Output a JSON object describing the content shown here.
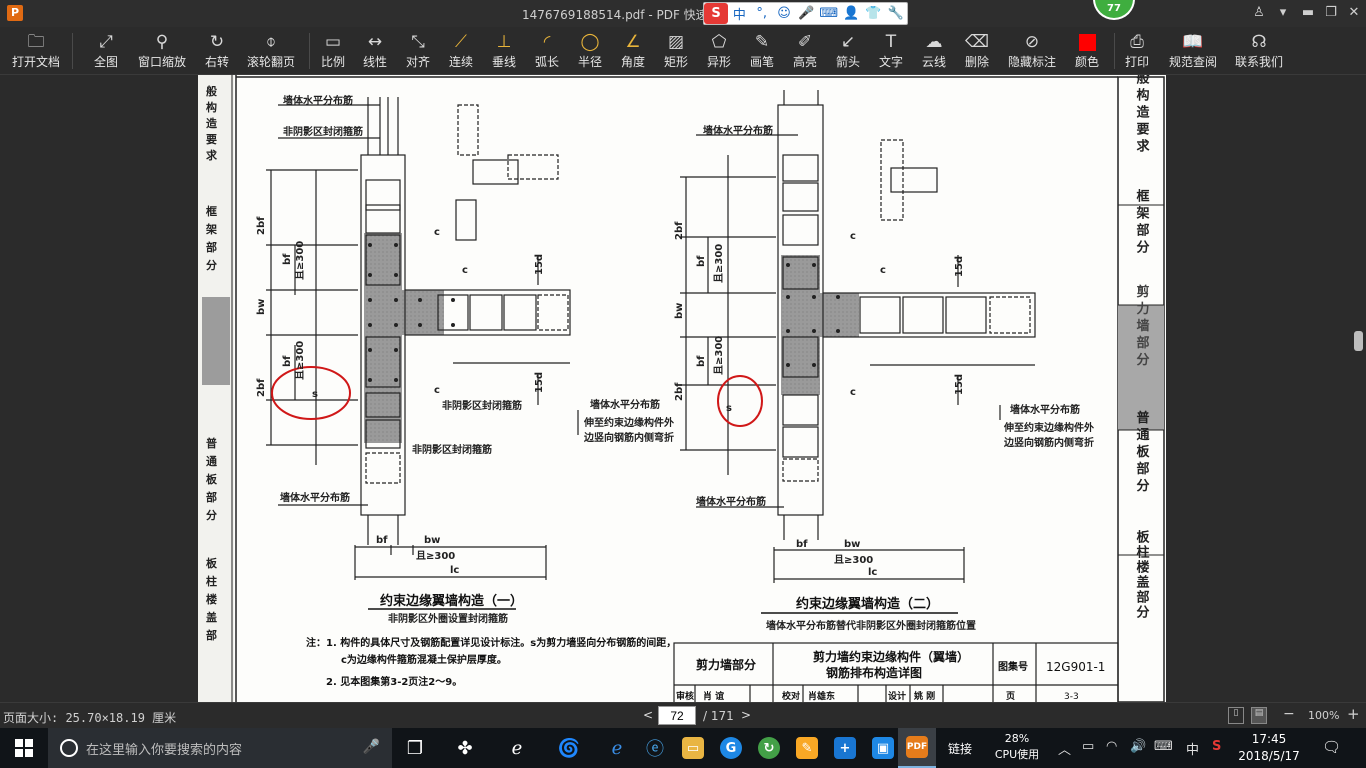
{
  "titlebar": {
    "app_icon": "P",
    "title": "1476769188514.pdf - PDF 快速看",
    "ime": {
      "logo": "S",
      "mode": "中",
      "punct": "°,",
      "icons": [
        "smiley-icon",
        "mic-icon",
        "keyboard-icon",
        "user-icon",
        "shirt-icon",
        "wrench-icon"
      ]
    },
    "badge": "77",
    "controls": [
      "user-icon",
      "chevron-down-icon",
      "minimize-icon",
      "maximize-icon",
      "close-icon"
    ]
  },
  "toolbar": {
    "tools": [
      {
        "label": "打开文档",
        "icon": "folder-icon"
      },
      {
        "label": "全图",
        "icon": "fullscreen-icon"
      },
      {
        "label": "窗口缩放",
        "icon": "magnifier-icon"
      },
      {
        "label": "右转",
        "icon": "rotate-right-icon"
      },
      {
        "label": "滚轮翻页",
        "icon": "mouse-icon"
      },
      {
        "label": "比例",
        "icon": "scale-icon"
      },
      {
        "label": "线性",
        "icon": "linear-icon"
      },
      {
        "label": "对齐",
        "icon": "align-icon"
      },
      {
        "label": "连续",
        "icon": "continuous-icon"
      },
      {
        "label": "垂线",
        "icon": "perpendicular-icon"
      },
      {
        "label": "弧长",
        "icon": "arc-icon"
      },
      {
        "label": "半径",
        "icon": "radius-icon"
      },
      {
        "label": "角度",
        "icon": "angle-icon"
      },
      {
        "label": "矩形",
        "icon": "rectangle-icon"
      },
      {
        "label": "异形",
        "icon": "polygon-icon"
      },
      {
        "label": "画笔",
        "icon": "pen-icon"
      },
      {
        "label": "高亮",
        "icon": "highlighter-icon"
      },
      {
        "label": "箭头",
        "icon": "arrow-icon"
      },
      {
        "label": "文字",
        "icon": "text-icon"
      },
      {
        "label": "云线",
        "icon": "cloud-icon"
      },
      {
        "label": "删除",
        "icon": "eraser-icon"
      },
      {
        "label": "隐藏标注",
        "icon": "eye-slash-icon"
      },
      {
        "label": "颜色",
        "icon": "color-swatch-icon"
      },
      {
        "label": "打印",
        "icon": "printer-icon"
      },
      {
        "label": "规范查阅",
        "icon": "book-icon"
      },
      {
        "label": "联系我们",
        "icon": "headset-icon"
      }
    ],
    "color_swatch": "#ff0000"
  },
  "document": {
    "left_strip_labels": [
      "般",
      "构",
      "造",
      "要",
      "求",
      "框",
      "架",
      "部",
      "分",
      "普",
      "通",
      "板",
      "部",
      "分",
      "板",
      "柱",
      "楼",
      "盖",
      "部"
    ],
    "side_tabs": [
      {
        "text": "一般构造要求"
      },
      {
        "text": "框架部分"
      },
      {
        "text": "剪力墙部分"
      },
      {
        "text": "普通板部分"
      },
      {
        "text": "板柱楼盖部分"
      }
    ],
    "left_drawing": {
      "labels": {
        "horiz_top1": "墙体水平分布筋",
        "horiz_top2": "非阴影区封闭箍筋",
        "side_2bf": "2bf",
        "side_bf": "bf",
        "side_gt300": "且≥300",
        "side_bw": "bw",
        "side_gt300b": "且≥300",
        "side_bf2": "bf",
        "side_2bf2": "2bf",
        "c1": "c",
        "c2": "c",
        "c3": "c",
        "d15a": "15d",
        "d15b": "15d",
        "non_shadow": "非阴影区封闭箍筋",
        "non_shadow2": "非阴影区封闭箍筋",
        "horiz_right": "墙体水平分布筋",
        "extend1": "伸至约束边缘构件外",
        "extend2": "边竖向钢筋内侧弯折",
        "horiz_bottom": "墙体水平分布筋",
        "dim_bf": "bf",
        "dim_bw": "bw",
        "dim_gt300": "且≥300",
        "dim_lc": "lc",
        "s": "s"
      },
      "title": "约束边缘翼墙构造（一）",
      "subtitle": "非阴影区外圈设置封闭箍筋"
    },
    "right_drawing": {
      "labels": {
        "horiz_top": "墙体水平分布筋",
        "side_2bf": "2bf",
        "side_bf": "bf",
        "side_gt300": "且≥300",
        "side_bw": "bw",
        "side_gt300b": "且≥300",
        "side_bf2": "bf",
        "side_2bf2": "2bf",
        "c1": "c",
        "c2": "c",
        "c3": "c",
        "d15a": "15d",
        "d15b": "15d",
        "horiz_right": "墙体水平分布筋",
        "extend1": "伸至约束边缘构件外",
        "extend2": "边竖向钢筋内侧弯折",
        "horiz_bottom": "墙体水平分布筋",
        "dim_bf": "bf",
        "dim_bw": "bw",
        "dim_gt300": "且≥300",
        "dim_lc": "lc",
        "s": "s"
      },
      "title": "约束边缘翼墙构造（二）",
      "subtitle": "墙体水平分布筋替代非阴影区外圈封闭箍筋位置"
    },
    "notes": {
      "line1": "注：1. 构件的具体尺寸及钢筋配置详见设计标注。s为剪力墙竖向分布钢筋的间距，",
      "line2": "c为边缘构件箍筋混凝土保护层厚度。",
      "line3": "2. 见本图集第3-2页注2～9。"
    },
    "title_block": {
      "section": "剪力墙部分",
      "drawing_title1": "剪力墙约束边缘构件（翼墙）",
      "drawing_title2": "钢筋排布构造详图",
      "atlas_label": "图集号",
      "atlas_no": "12G901-1",
      "row2": [
        "审核",
        "肖 谊",
        "校对",
        "肖雄东",
        "设计",
        "姚 刚",
        "页",
        "3-3"
      ]
    }
  },
  "statusbar": {
    "page_size": "页面大小: 25.70×18.19 厘米",
    "current_page": "72",
    "total_pages": "/ 171",
    "zoom": "100%"
  },
  "taskbar": {
    "search_placeholder": "在这里输入你要搜索的内容",
    "apps": [
      "task-view-icon",
      "pinwheel-icon",
      "edge-e-icon",
      "swirl-app-icon",
      "edge-icon",
      "ie-icon",
      "explorer-icon",
      "g-app-icon",
      "refresh-app-icon",
      "notes-icon",
      "plus-app-icon",
      "briefcase-icon",
      "pdf-app-icon"
    ],
    "tray_link": "链接",
    "cpu_percent": "28%",
    "cpu_label": "CPU使用",
    "ime": "中",
    "time": "17:45",
    "date": "2018/5/17"
  }
}
